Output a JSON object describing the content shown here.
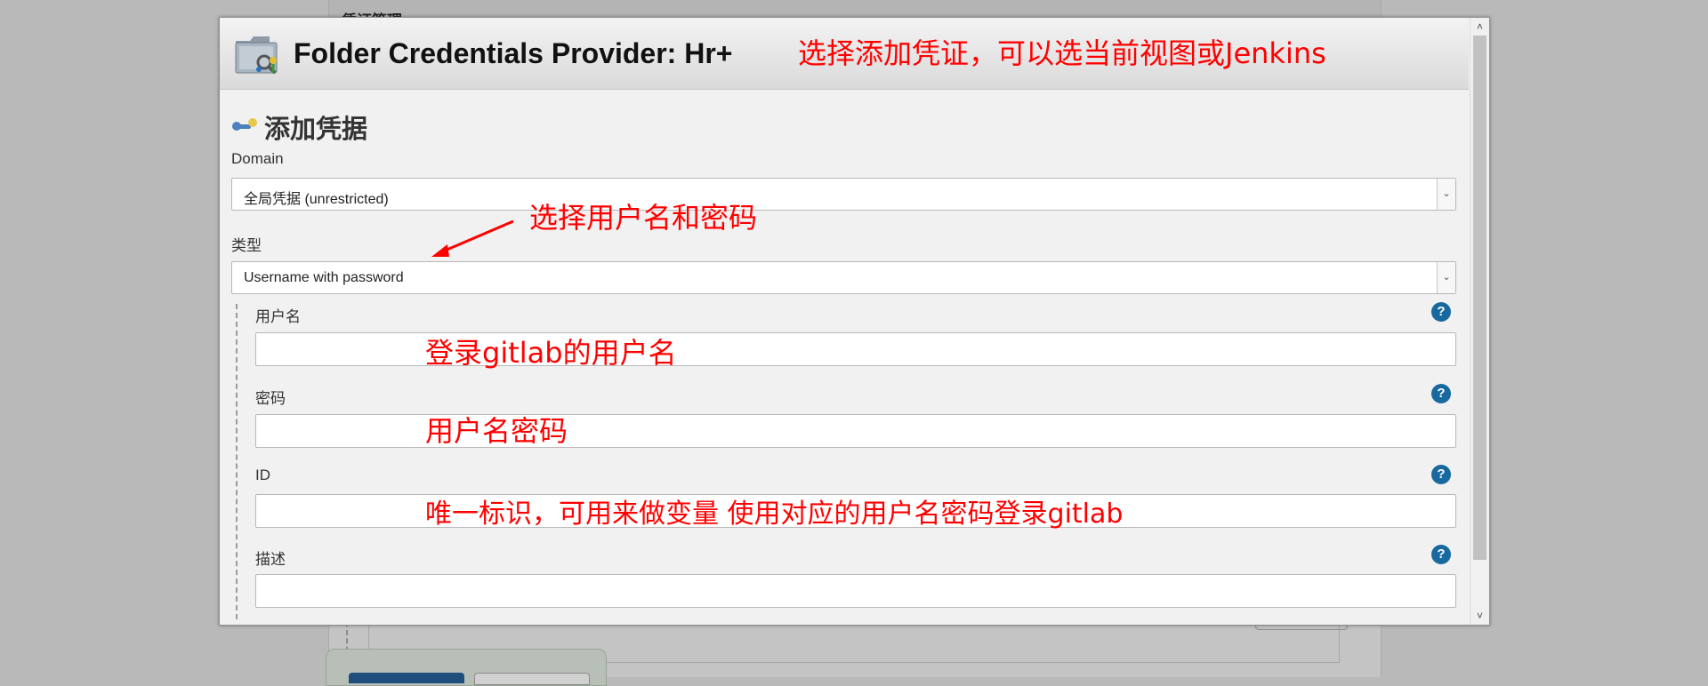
{
  "background": {
    "page_title": "凭证管理"
  },
  "modal": {
    "title": "Folder Credentials Provider: Hr+",
    "icon": "folder-credentials-icon",
    "section_title": "添加凭据",
    "section_icon": "key-icon",
    "domain": {
      "label": "Domain",
      "value": "全局凭据 (unrestricted)"
    },
    "kind": {
      "label": "类型",
      "value": "Username with password"
    },
    "fields": {
      "username": {
        "label": "用户名",
        "value": ""
      },
      "password": {
        "label": "密码",
        "value": ""
      },
      "id": {
        "label": "ID",
        "value": ""
      },
      "description": {
        "label": "描述",
        "value": ""
      }
    },
    "help_symbol": "?"
  },
  "annotations": {
    "header": "选择添加凭证，可以选当前视图或Jenkins",
    "kind": "选择用户名和密码",
    "username": "登录gitlab的用户名",
    "password": "用户名密码",
    "id": "唯一标识，可用来做变量 使用对应的用户名密码登录gitlab"
  },
  "colors": {
    "annotation": "#ff0000",
    "help_icon": "#17699f",
    "background": "#b9b9b9"
  }
}
